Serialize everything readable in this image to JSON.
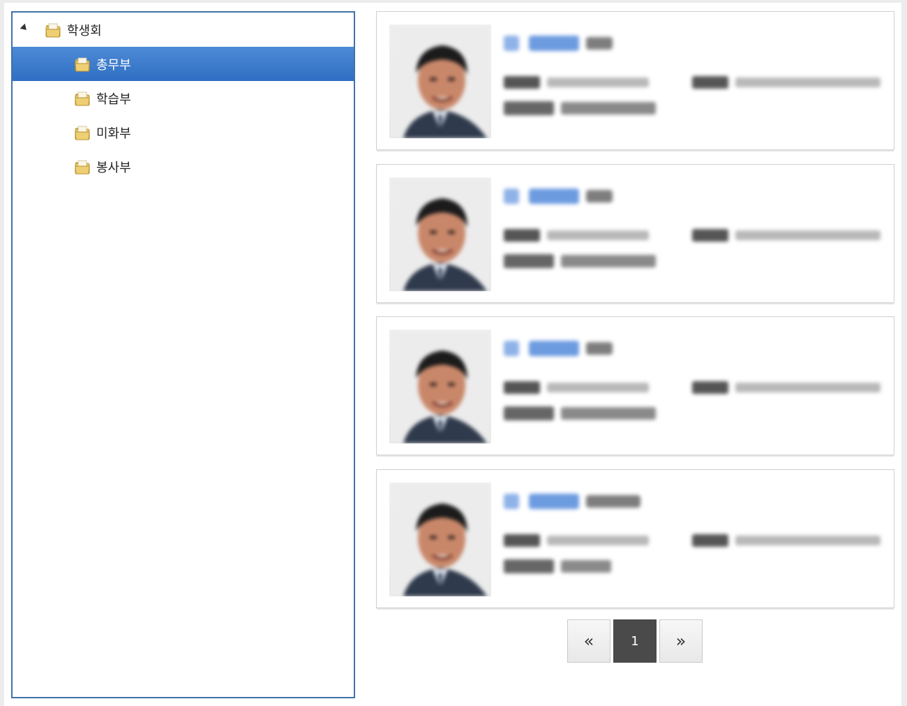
{
  "tree": {
    "root": {
      "label": "학생회",
      "expanded": true
    },
    "children": [
      {
        "label": "총무부",
        "selected": true
      },
      {
        "label": "학습부",
        "selected": false
      },
      {
        "label": "미화부",
        "selected": false
      },
      {
        "label": "봉사부",
        "selected": false
      }
    ]
  },
  "cards_count_note": "4 member cards with blurred photo and details",
  "pagination": {
    "prev_label": "«",
    "current_page": "1",
    "next_label": "»"
  },
  "colors": {
    "tree_border": "#3f72a8",
    "selected_bg": "#2f6ec3",
    "name_link": "#6d9be0",
    "page_current_bg": "#4a4a4a"
  },
  "icons": {
    "tree_toggle": "triangle-down-icon",
    "folder": "folder-icon",
    "prev": "double-chevron-left-icon",
    "next": "double-chevron-right-icon"
  }
}
